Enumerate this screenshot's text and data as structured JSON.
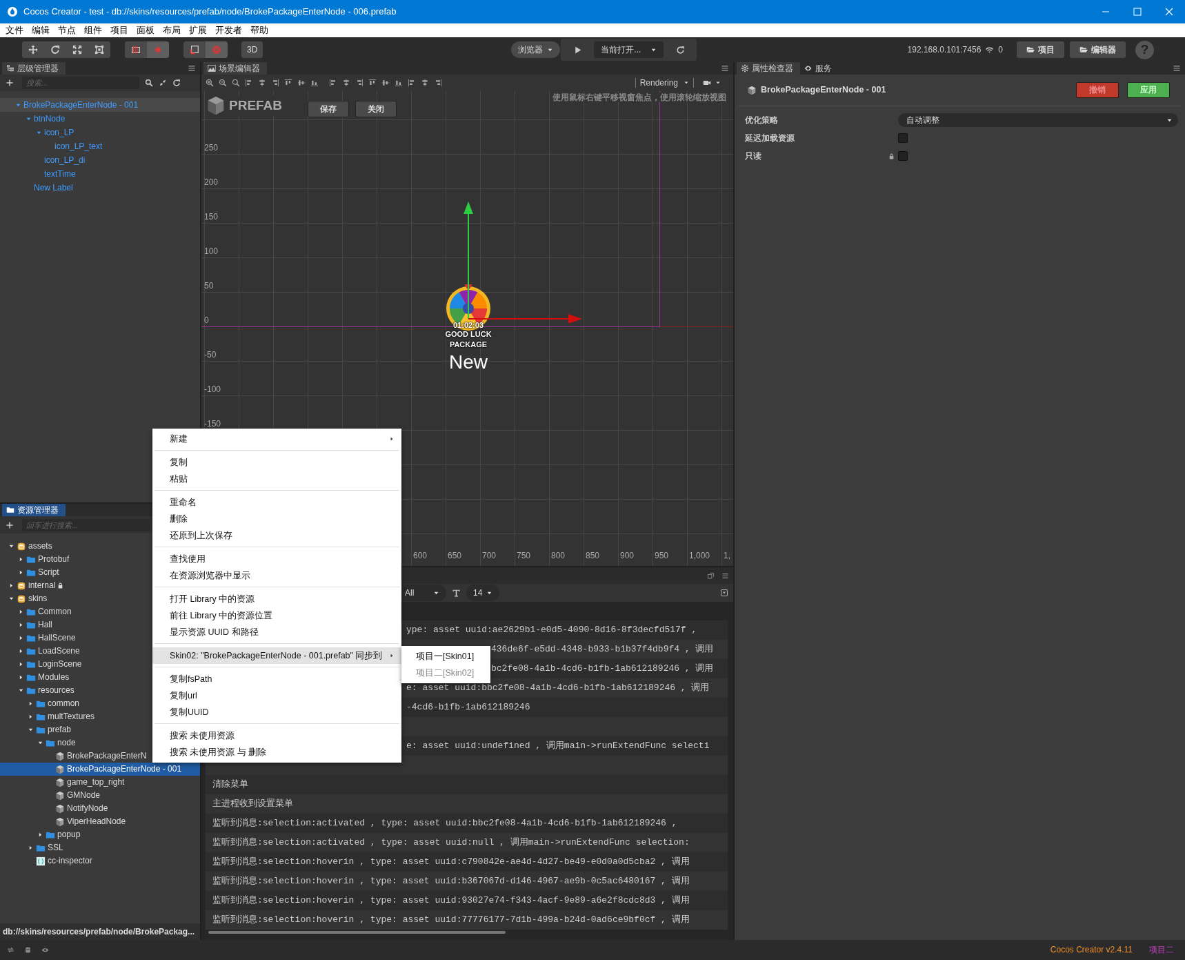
{
  "window": {
    "title": "Cocos Creator - test - db://skins/resources/prefab/node/BrokePackageEnterNode - 006.prefab"
  },
  "menu_bar": [
    "文件",
    "编辑",
    "节点",
    "组件",
    "项目",
    "面板",
    "布局",
    "扩展",
    "开发者",
    "帮助"
  ],
  "toolbar": {
    "tool_groups": [
      {
        "tools": [
          {
            "kind": "move",
            "selected": false
          },
          {
            "kind": "rotate",
            "selected": false
          },
          {
            "kind": "scale",
            "selected": false
          },
          {
            "kind": "rect",
            "selected": false
          }
        ]
      },
      {
        "tools": [
          {
            "kind": "pivot",
            "selected": false
          },
          {
            "kind": "center",
            "selected": true
          }
        ]
      },
      {
        "tools": [
          {
            "kind": "local",
            "selected": false
          },
          {
            "kind": "global",
            "selected": true
          }
        ]
      }
    ],
    "mode": "3D",
    "platform": "浏览器",
    "scene_target": "当前打开...",
    "server_address": "192.168.0.101:7456",
    "connections": "0",
    "buttons": [
      "项目",
      "编辑器"
    ],
    "help": "?"
  },
  "hierarchy": {
    "title": "层级管理器",
    "search": {
      "placeholder": "搜索..."
    },
    "tree": [
      {
        "label": "BrokePackageEnterNode - 001",
        "expanded": true,
        "selected": true,
        "children": [
          {
            "label": "btnNode",
            "expanded": true,
            "selected": false,
            "children": [
              {
                "label": "icon_LP",
                "expanded": true,
                "selected": false,
                "children": [
                  {
                    "label": "icon_LP_text",
                    "selected": false
                  }
                ]
              },
              {
                "label": "icon_LP_di",
                "selected": false
              },
              {
                "label": "textTime",
                "selected": false
              }
            ]
          },
          {
            "label": "New Label",
            "selected": false
          }
        ]
      }
    ]
  },
  "assets": {
    "title": "资源管理器",
    "search": {
      "placeholder": "回车进行搜索..."
    },
    "tree": [
      {
        "label": "assets",
        "kind": "mount",
        "locked": false,
        "expanded": true,
        "selected": false,
        "children": [
          {
            "label": "Protobuf",
            "kind": "folder",
            "expanded": false,
            "selected": false
          },
          {
            "label": "Script",
            "kind": "folder",
            "expanded": false,
            "selected": false
          }
        ]
      },
      {
        "label": "internal",
        "kind": "mount",
        "locked": true,
        "expanded": false,
        "selected": false
      },
      {
        "label": "skins",
        "kind": "mount",
        "locked": false,
        "expanded": true,
        "selected": false,
        "children": [
          {
            "label": "Common",
            "kind": "folder",
            "expanded": false,
            "selected": false
          },
          {
            "label": "Hall",
            "kind": "folder",
            "expanded": false,
            "selected": false
          },
          {
            "label": "HallScene",
            "kind": "folder",
            "expanded": false,
            "selected": false
          },
          {
            "label": "LoadScene",
            "kind": "folder",
            "expanded": false,
            "selected": false
          },
          {
            "label": "LoginScene",
            "kind": "folder",
            "expanded": false,
            "selected": false
          },
          {
            "label": "Modules",
            "kind": "folder",
            "expanded": false,
            "selected": false
          },
          {
            "label": "resources",
            "kind": "folder",
            "expanded": true,
            "selected": false,
            "children": [
              {
                "label": "common",
                "kind": "folder",
                "expanded": false,
                "selected": false
              },
              {
                "label": "multTextures",
                "kind": "folder",
                "expanded": false,
                "selected": false
              },
              {
                "label": "prefab",
                "kind": "folder",
                "expanded": true,
                "selected": false,
                "children": [
                  {
                    "label": "node",
                    "kind": "folder",
                    "expanded": true,
                    "selected": false,
                    "children": [
                      {
                        "label": "BrokePackageEnterN",
                        "kind": "prefab",
                        "selected": false
                      },
                      {
                        "label": "BrokePackageEnterNode - 001",
                        "kind": "prefab",
                        "selected": true
                      },
                      {
                        "label": "game_top_right",
                        "kind": "prefab",
                        "selected": false
                      },
                      {
                        "label": "GMNode",
                        "kind": "prefab",
                        "selected": false
                      },
                      {
                        "label": "NotifyNode",
                        "kind": "prefab",
                        "selected": false
                      },
                      {
                        "label": "ViperHeadNode",
                        "kind": "prefab",
                        "selected": false
                      }
                    ]
                  },
                  {
                    "label": "popup",
                    "kind": "folder",
                    "expanded": false,
                    "selected": false
                  }
                ]
              },
              {
                "label": "SSL",
                "kind": "folder",
                "expanded": false,
                "selected": false
              },
              {
                "label": "cc-inspector",
                "kind": "script",
                "selected": false
              }
            ]
          }
        ]
      }
    ],
    "path": "db://skins/resources/prefab/node/BrokePackag..."
  },
  "scene": {
    "title": "场景编辑器",
    "render_mode": "Rendering",
    "prefab_label": "PREFAB",
    "buttons": [
      "保存",
      "关闭"
    ],
    "hint": "使用鼠标右键平移视窗焦点，使用滚轮缩放视图",
    "y_labels": [
      "250",
      "200",
      "150",
      "100",
      "50",
      "0",
      "-50",
      "-100",
      "-150"
    ],
    "x_labels": [
      "600",
      "650",
      "700",
      "750",
      "800",
      "850",
      "900",
      "950",
      "1,000",
      "1,"
    ],
    "node": {
      "timer": "01:02:03",
      "caption_lines": [
        "GOOD LUCK",
        "PACKAGE"
      ],
      "label": "New"
    }
  },
  "console": {
    "filter": "All",
    "font_size": "14",
    "lines": [
      {
        "kind": "after-menu",
        "text": "ype: asset uuid:ae2629b1-e0d5-4090-8d16-8f3decfd517f ,"
      },
      {
        "kind": "after-submenu",
        "text": "436de6f-e5dd-4348-b933-b1b37f4db9f4 , 调用"
      },
      {
        "kind": "after-submenu",
        "text": "bc2fe08-4a1b-4cd6-b1fb-1ab612189246 , 调用"
      },
      {
        "kind": "after-menu",
        "text": "e: asset uuid:bbc2fe08-4a1b-4cd6-b1fb-1ab612189246 , 调用"
      },
      {
        "kind": "after-menu",
        "text": "-4cd6-b1fb-1ab612189246"
      },
      {
        "kind": "blank"
      },
      {
        "kind": "after-menu",
        "text": "e: asset uuid:undefined , 调用main->runExtendFunc selecti"
      },
      {
        "kind": "blank"
      },
      {
        "kind": "full",
        "text": "清除菜单"
      },
      {
        "kind": "full",
        "text": "主进程收到设置菜单"
      },
      {
        "kind": "full",
        "text": "监听到消息:selection:activated , type: asset uuid:bbc2fe08-4a1b-4cd6-b1fb-1ab612189246 ,"
      },
      {
        "kind": "full",
        "text": "监听到消息:selection:activated , type: asset uuid:null , 调用main->runExtendFunc selection:"
      },
      {
        "kind": "full",
        "text": "监听到消息:selection:hoverin , type: asset uuid:c790842e-ae4d-4d27-be49-e0d0a0d5cba2 , 调用"
      },
      {
        "kind": "full",
        "text": "监听到消息:selection:hoverin , type: asset uuid:b367067d-d146-4967-ae9b-0c5ac6480167 , 调用"
      },
      {
        "kind": "full",
        "text": "监听到消息:selection:hoverin , type: asset uuid:93027e74-f343-4acf-9e89-a6e2f8cdc8d3 , 调用"
      },
      {
        "kind": "full",
        "text": "监听到消息:selection:hoverin , type: asset uuid:77776177-7d1b-499a-b24d-0ad6ce9bf0cf , 调用"
      }
    ]
  },
  "inspector": {
    "tabs": [
      {
        "label": "属性检查器",
        "selected": true
      },
      {
        "label": "服务",
        "selected": false
      }
    ],
    "node_name": "BrokePackageEnterNode - 001",
    "actions": [
      {
        "label": "撤销",
        "kind": "revert"
      },
      {
        "label": "应用",
        "kind": "apply"
      }
    ],
    "properties": [
      {
        "label": "优化策略",
        "kind": "select",
        "value": "自动调整"
      },
      {
        "label": "延迟加载资源",
        "kind": "checkbox",
        "checked": false,
        "locked": false
      },
      {
        "label": "只读",
        "kind": "checkbox",
        "checked": false,
        "locked": true
      }
    ]
  },
  "context_menu": {
    "groups": [
      {
        "items": [
          {
            "label": "新建",
            "kind": "submenu",
            "selected": false
          }
        ]
      },
      {
        "items": [
          {
            "label": "复制",
            "kind": "action",
            "selected": false
          },
          {
            "label": "粘贴",
            "kind": "action",
            "selected": false
          }
        ]
      },
      {
        "items": [
          {
            "label": "重命名",
            "kind": "action",
            "selected": false
          },
          {
            "label": "删除",
            "kind": "action",
            "selected": false
          },
          {
            "label": "还原到上次保存",
            "kind": "action",
            "selected": false
          }
        ]
      },
      {
        "items": [
          {
            "label": "查找使用",
            "kind": "action",
            "selected": false
          },
          {
            "label": "在资源浏览器中显示",
            "kind": "action",
            "selected": false
          }
        ]
      },
      {
        "items": [
          {
            "label": "打开 Library 中的资源",
            "kind": "action",
            "selected": false
          },
          {
            "label": "前往 Library 中的资源位置",
            "kind": "action",
            "selected": false
          },
          {
            "label": "显示资源 UUID 和路径",
            "kind": "action",
            "selected": false
          }
        ]
      },
      {
        "items": [
          {
            "label": "Skin02: \"BrokePackageEnterNode - 001.prefab\" 同步到",
            "kind": "submenu",
            "selected": true
          }
        ]
      },
      {
        "items": [
          {
            "label": "复制fsPath",
            "kind": "action",
            "selected": false
          },
          {
            "label": "复制url",
            "kind": "action",
            "selected": false
          },
          {
            "label": "复制UUID",
            "kind": "action",
            "selected": false
          }
        ]
      },
      {
        "items": [
          {
            "label": "搜索 未使用资源",
            "kind": "action",
            "selected": false
          },
          {
            "label": "搜索 未使用资源 与 删除",
            "kind": "action",
            "selected": false
          }
        ]
      }
    ],
    "submenu": {
      "items": [
        {
          "label": "项目一[Skin01]",
          "disabled": false
        },
        {
          "label": "项目二[Skin02]",
          "disabled": true
        }
      ]
    }
  },
  "status_bar": {
    "version": "Cocos Creator v2.4.11",
    "project": "项目二"
  }
}
